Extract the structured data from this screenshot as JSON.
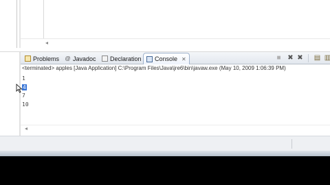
{
  "tabs": [
    {
      "label": "Problems",
      "icon": "problems-icon",
      "active": false
    },
    {
      "label": "Javadoc",
      "icon": "javadoc-icon",
      "active": false
    },
    {
      "label": "Declaration",
      "icon": "declaration-icon",
      "active": false
    },
    {
      "label": "Console",
      "icon": "console-icon",
      "active": true
    }
  ],
  "console": {
    "header": "<terminated> apples [Java Application] C:\\Program Files\\Java\\jre6\\bin\\javaw.exe (May 10, 2009 1:06:39 PM)",
    "lines": [
      "1",
      "4",
      "7",
      "10"
    ]
  },
  "toolbar_icons": [
    "terminate-icon",
    "remove-launch-icon",
    "remove-all-terminated-icon",
    "clear-console-icon"
  ],
  "colors": {
    "selection": "#3875d7",
    "tab_active_border": "#9fb2cc"
  }
}
